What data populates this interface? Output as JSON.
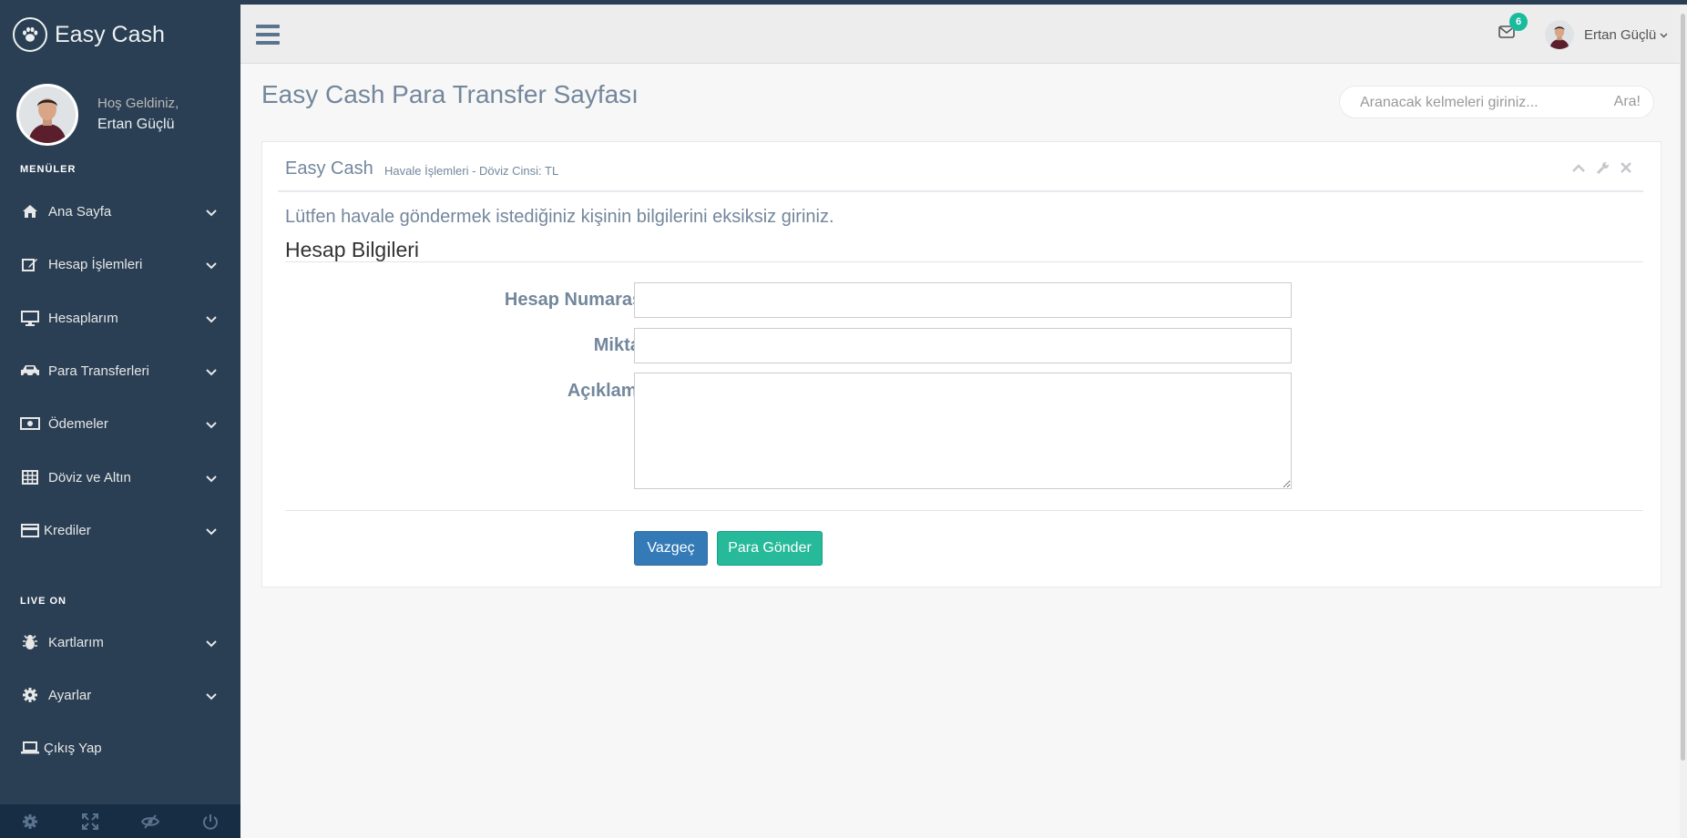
{
  "brand": {
    "title": "Easy Cash"
  },
  "profile": {
    "welcome": "Hoş Geldiniz,",
    "name": "Ertan Güçlü"
  },
  "sidebar": {
    "section_menu": "MENÜLER",
    "section_live": "LIVE ON",
    "items": [
      {
        "label": "Ana Sayfa",
        "icon": "home-icon"
      },
      {
        "label": "Hesap İşlemleri",
        "icon": "edit-icon"
      },
      {
        "label": "Hesaplarım",
        "icon": "desktop-icon"
      },
      {
        "label": "Para Transferleri",
        "icon": "car-icon"
      },
      {
        "label": "Ödemeler",
        "icon": "money-icon"
      },
      {
        "label": "Döviz ve Altın",
        "icon": "table-icon"
      },
      {
        "label": "Krediler",
        "icon": "credit-card-icon"
      }
    ],
    "live_items": [
      {
        "label": "Kartlarım",
        "icon": "bug-icon"
      },
      {
        "label": "Ayarlar",
        "icon": "gear-icon"
      },
      {
        "label": "Çıkış Yap",
        "icon": "laptop-icon"
      }
    ],
    "footer_icons": [
      "settings-icon",
      "fullscreen-icon",
      "lock-icon",
      "logout-icon"
    ]
  },
  "topnav": {
    "mail_count": "6",
    "user_name": "Ertan Güçlü"
  },
  "page": {
    "title": "Easy Cash Para Transfer Sayfası",
    "search_placeholder": "Aranacak kelmeleri giriniz...",
    "search_button": "Ara!"
  },
  "panel": {
    "title": "Easy Cash",
    "subtitle": "Havale İşlemleri - Döviz Cinsi: TL",
    "intro": "Lütfen havale göndermek istediğiniz kişinin bilgilerini eksiksiz giriniz.",
    "section": "Hesap Bilgileri",
    "fields": {
      "account_label": "Hesap Numarası *",
      "account_value": "",
      "amount_label": "Miktar *",
      "amount_value": "",
      "description_label": "Açıklama *",
      "description_value": ""
    },
    "buttons": {
      "cancel": "Vazgeç",
      "send": "Para Gönder"
    }
  },
  "colors": {
    "sidebar": "#2a3f54",
    "accent_green": "#26b99a",
    "primary_blue": "#337ab7",
    "text": "#73879c"
  }
}
